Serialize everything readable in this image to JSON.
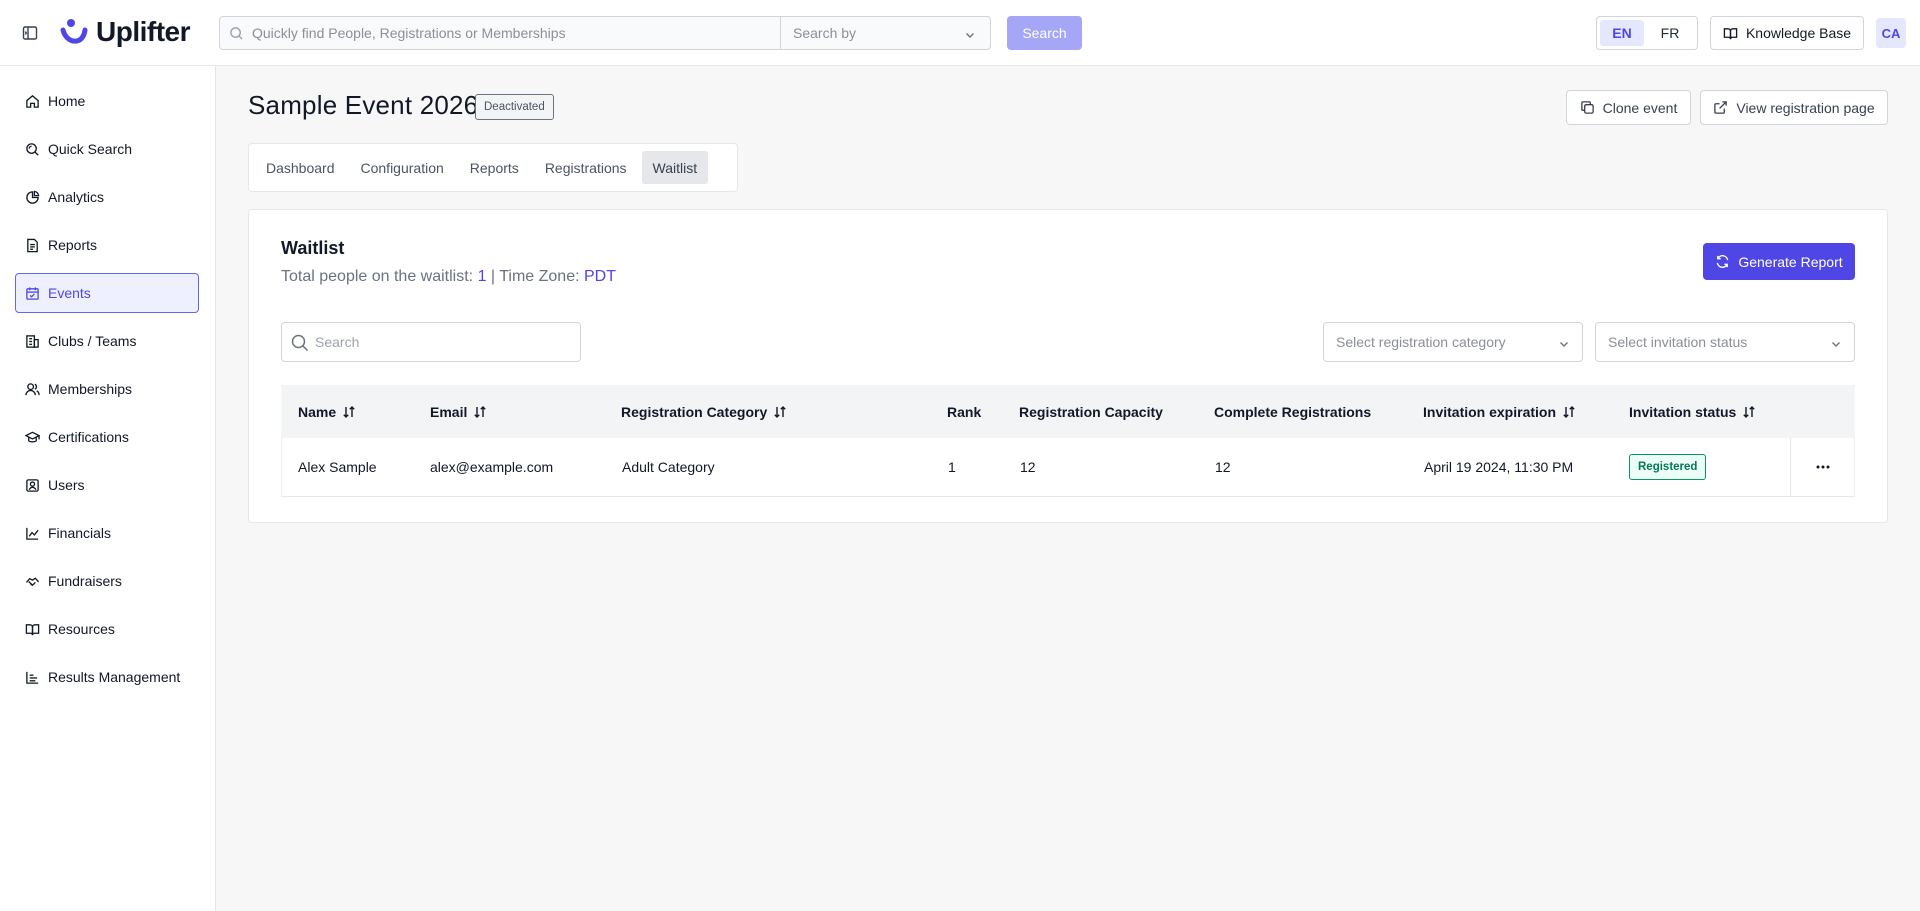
{
  "header": {
    "brand": "Uplifter",
    "search_placeholder": "Quickly find People, Registrations or Memberships",
    "search_by": "Search by",
    "search_button": "Search",
    "lang_en": "EN",
    "lang_fr": "FR",
    "knowledge_base": "Knowledge Base",
    "avatar": "CA",
    "accent_color": "#4f46e5"
  },
  "sidebar": {
    "items": [
      {
        "label": "Home",
        "icon": "home-icon"
      },
      {
        "label": "Quick Search",
        "icon": "quick-search-icon"
      },
      {
        "label": "Analytics",
        "icon": "pie-chart-icon"
      },
      {
        "label": "Reports",
        "icon": "document-icon"
      },
      {
        "label": "Events",
        "icon": "calendar-icon",
        "active": true
      },
      {
        "label": "Clubs / Teams",
        "icon": "building-icon"
      },
      {
        "label": "Memberships",
        "icon": "members-icon"
      },
      {
        "label": "Certifications",
        "icon": "graduation-cap-icon"
      },
      {
        "label": "Users",
        "icon": "user-icon"
      },
      {
        "label": "Financials",
        "icon": "chart-icon"
      },
      {
        "label": "Fundraisers",
        "icon": "handshake-icon"
      },
      {
        "label": "Resources",
        "icon": "book-icon"
      },
      {
        "label": "Results Management",
        "icon": "bar-chart-icon"
      }
    ]
  },
  "event": {
    "title": "Sample Event 2026",
    "status": "Deactivated",
    "clone_label": "Clone event",
    "view_registration_label": "View registration page"
  },
  "tabs": [
    {
      "label": "Dashboard"
    },
    {
      "label": "Configuration"
    },
    {
      "label": "Reports"
    },
    {
      "label": "Registrations"
    },
    {
      "label": "Waitlist",
      "active": true
    }
  ],
  "waitlist": {
    "title": "Waitlist",
    "total_prefix": "Total people on the waitlist: ",
    "total_count": "1",
    "tz_sep": " | Time Zone: ",
    "time_zone": "PDT",
    "generate_report": "Generate Report",
    "search_placeholder": "Search",
    "category_placeholder": "Select registration category",
    "invitation_placeholder": "Select invitation status",
    "columns": [
      "Name",
      "Email",
      "Registration Category",
      "Rank",
      "Registration Capacity",
      "Complete Registrations",
      "Invitation expiration",
      "Invitation status"
    ],
    "rows": [
      {
        "name": "Alex Sample",
        "email": "alex@example.com",
        "category": "Adult Category",
        "rank": "1",
        "capacity": "12",
        "complete": "12",
        "expiration": "April 19 2024, 11:30 PM",
        "status": "Registered"
      }
    ]
  }
}
